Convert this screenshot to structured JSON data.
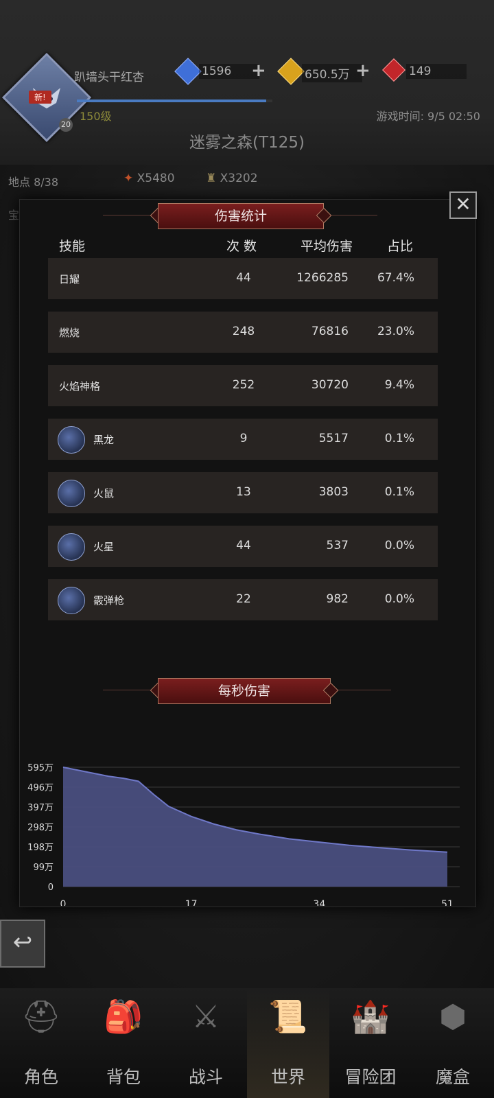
{
  "header": {
    "player_name": "趴墙头干红杏",
    "new_badge": "新!",
    "level_badge": "20",
    "level": "150级",
    "game_time": "游戏时间: 9/5 02:50",
    "currencies": [
      {
        "value": "1596",
        "color": "#3f6fd8",
        "icon": "blue-gem-icon"
      },
      {
        "value": "650.5万",
        "color": "#d8a21d",
        "icon": "gold-gem-icon"
      },
      {
        "value": "149",
        "color": "#c2262a",
        "icon": "red-gem-icon"
      }
    ],
    "map_title": "迷雾之森(T125)",
    "location": "地点 8/38",
    "torch_count": "X5480",
    "key_count": "X3202",
    "chest_label": "宝箱"
  },
  "modal": {
    "damage_title": "伤害统计",
    "dps_title": "每秒伤害",
    "close_icon": "close-icon",
    "columns": [
      "技能",
      "次 数",
      "平均伤害",
      "占比"
    ],
    "rows": [
      {
        "name": "日耀",
        "count": "44",
        "avg": "1266285",
        "pct": "67.4%",
        "icon": ""
      },
      {
        "name": "燃烧",
        "count": "248",
        "avg": "76816",
        "pct": "23.0%",
        "icon": ""
      },
      {
        "name": "火焰神格",
        "count": "252",
        "avg": "30720",
        "pct": "9.4%",
        "icon": ""
      },
      {
        "name": "黑龙",
        "count": "9",
        "avg": "5517",
        "pct": "0.1%",
        "icon": "dragon-skill-icon"
      },
      {
        "name": "火鼠",
        "count": "13",
        "avg": "3803",
        "pct": "0.1%",
        "icon": "fire-rat-skill-icon"
      },
      {
        "name": "火星",
        "count": "44",
        "avg": "537",
        "pct": "0.0%",
        "icon": "sword-skill-icon"
      },
      {
        "name": "霰弹枪",
        "count": "22",
        "avg": "982",
        "pct": "0.0%",
        "icon": "sword-skill-icon"
      }
    ]
  },
  "chart_data": {
    "type": "area",
    "title": "每秒伤害",
    "xlabel": "",
    "ylabel": "",
    "x_ticks": [
      "0",
      "17",
      "34",
      "51"
    ],
    "y_ticks": [
      "0",
      "99万",
      "198万",
      "298万",
      "397万",
      "496万",
      "595万"
    ],
    "xlim": [
      0,
      51
    ],
    "ylim": [
      0,
      595
    ],
    "grid": true,
    "fill_color": "#4a4f80",
    "line_color": "#6f78c8",
    "x": [
      0,
      2,
      4,
      6,
      8,
      10,
      12,
      14,
      17,
      20,
      23,
      26,
      30,
      34,
      38,
      42,
      46,
      51
    ],
    "values": [
      595,
      580,
      565,
      550,
      540,
      525,
      460,
      400,
      350,
      312,
      283,
      262,
      238,
      222,
      206,
      194,
      183,
      172
    ]
  },
  "nav": [
    {
      "label": "角色",
      "icon": "helmet-icon",
      "glyph": "⛑"
    },
    {
      "label": "背包",
      "icon": "backpack-icon",
      "glyph": "🎒"
    },
    {
      "label": "战斗",
      "icon": "shield-sword-icon",
      "glyph": "⚔"
    },
    {
      "label": "世界",
      "icon": "map-scroll-icon",
      "glyph": "📜",
      "active": true
    },
    {
      "label": "冒险团",
      "icon": "castle-icon",
      "glyph": "🏰"
    },
    {
      "label": "魔盒",
      "icon": "magic-box-icon",
      "glyph": "⬢"
    }
  ],
  "back_icon": "back-arrow-icon"
}
